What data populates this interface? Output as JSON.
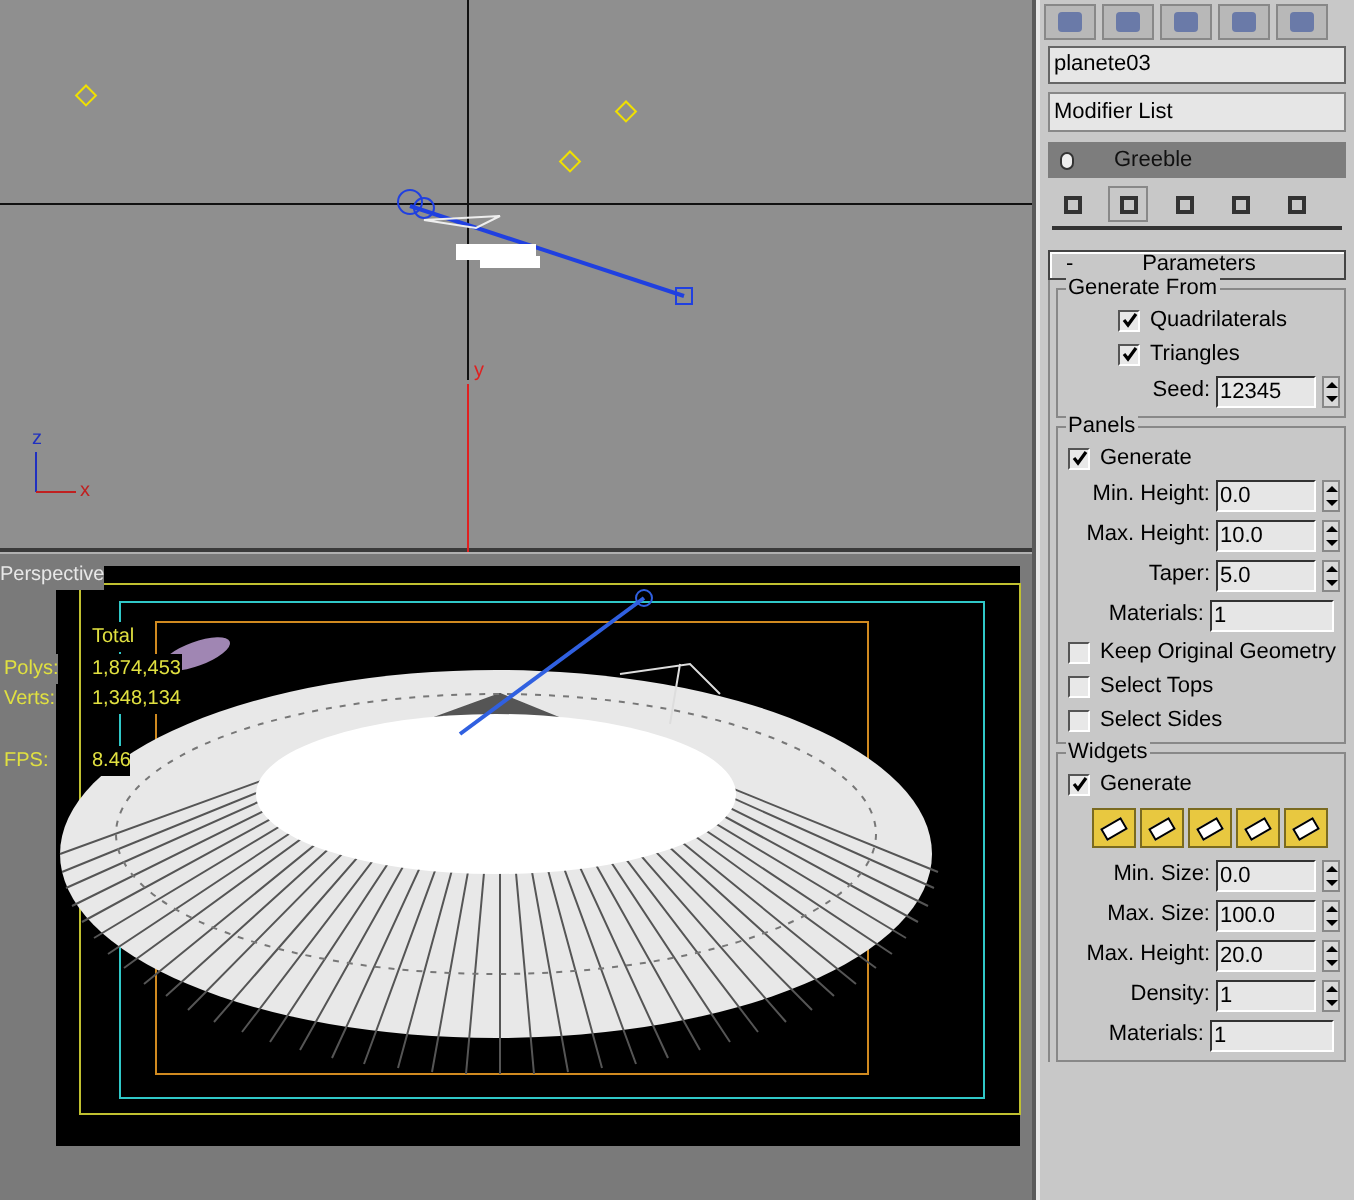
{
  "top_viewport": {
    "gizmo_labels": [
      "z",
      "x"
    ],
    "axis_label": "y"
  },
  "perspective_viewport": {
    "label": "Perspective",
    "stats": {
      "header": "Total",
      "rows": [
        {
          "label": "Polys:",
          "value": "1,874,453"
        },
        {
          "label": "Verts:",
          "value": "1,348,134"
        }
      ],
      "fps_label": "FPS:",
      "fps_value": "8.46"
    }
  },
  "command_panel": {
    "object_name": "planete03",
    "modifier_list": "Modifier List",
    "stack": [
      {
        "name": "Greeble",
        "selected": true
      }
    ],
    "rollout": {
      "collapse": "-",
      "title": "Parameters",
      "groups": [
        {
          "title": "Generate From",
          "items": [
            {
              "kind": "checkbox",
              "label": "Quadrilaterals",
              "checked": true,
              "indent": true
            },
            {
              "kind": "checkbox",
              "label": "Triangles",
              "checked": true,
              "indent": true
            },
            {
              "kind": "field",
              "label": "Seed:",
              "value": "12345",
              "spinner": true
            }
          ]
        },
        {
          "title": "Panels",
          "items": [
            {
              "kind": "checkbox",
              "label": "Generate",
              "checked": true
            },
            {
              "kind": "field",
              "label": "Min. Height:",
              "value": "0.0",
              "spinner": true
            },
            {
              "kind": "field",
              "label": "Max. Height:",
              "value": "10.0",
              "spinner": true
            },
            {
              "kind": "field",
              "label": "Taper:",
              "value": "5.0",
              "spinner": true
            },
            {
              "kind": "field",
              "label": "Materials:",
              "value": "1",
              "spinner": false
            },
            {
              "kind": "checkbox",
              "label": "Keep Original Geometry",
              "checked": false
            },
            {
              "kind": "checkbox",
              "label": "Select Tops",
              "checked": false
            },
            {
              "kind": "checkbox",
              "label": "Select Sides",
              "checked": false
            }
          ]
        },
        {
          "title": "Widgets",
          "items": [
            {
              "kind": "checkbox",
              "label": "Generate",
              "checked": true
            },
            {
              "kind": "widget_buttons",
              "buttons": [
                {
                  "selected": true
                },
                {
                  "selected": true
                },
                {
                  "selected": true
                },
                {
                  "selected": true
                },
                {
                  "selected": true
                }
              ]
            },
            {
              "kind": "field",
              "label": "Min. Size:",
              "value": "0.0",
              "spinner": true
            },
            {
              "kind": "field",
              "label": "Max. Size:",
              "value": "100.0",
              "spinner": true
            },
            {
              "kind": "field",
              "label": "Max. Height:",
              "value": "20.0",
              "spinner": true
            },
            {
              "kind": "field",
              "label": "Density:",
              "value": "1",
              "spinner": true
            },
            {
              "kind": "field",
              "label": "Materials:",
              "value": "1",
              "spinner": false
            }
          ]
        }
      ]
    }
  }
}
